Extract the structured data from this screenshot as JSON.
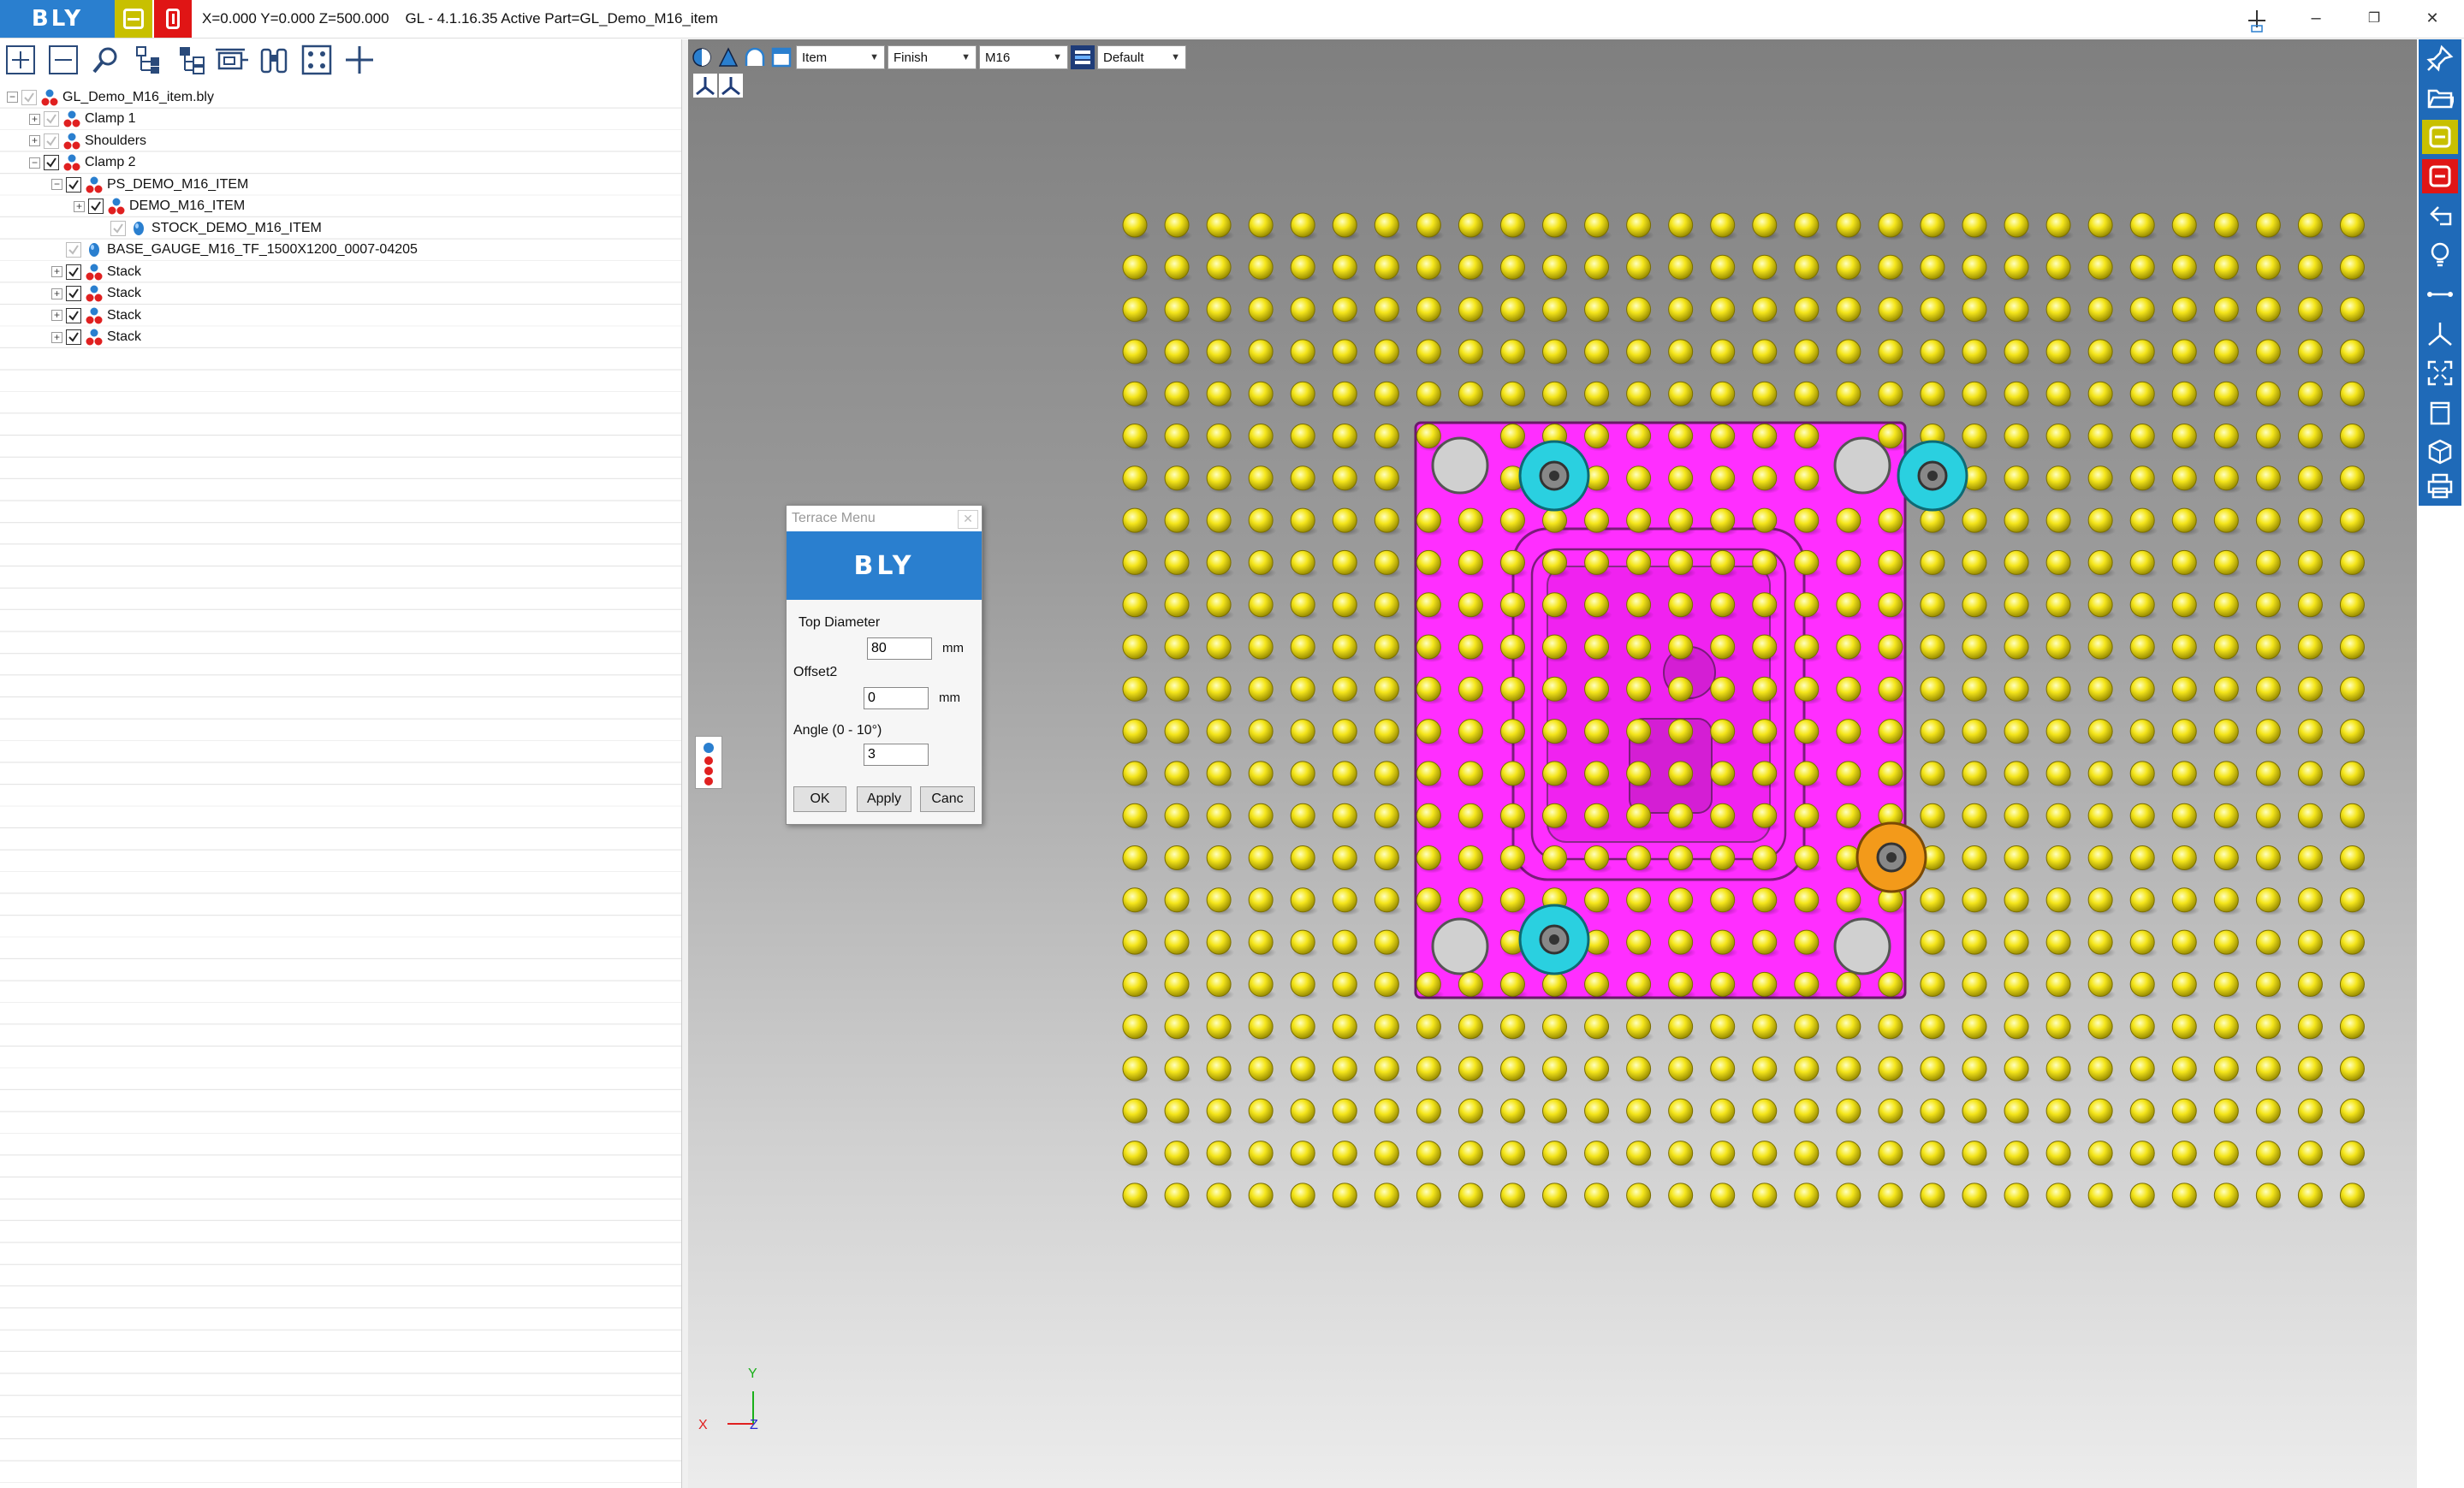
{
  "titlebar": {
    "logo": "BLY",
    "coords": "X=0.000 Y=0.000 Z=500.000",
    "title": "GL - 4.1.16.35 Active Part=GL_Demo_M16_item",
    "minimize": "–",
    "restore": "❐",
    "close": "✕"
  },
  "left_toolbar": [
    "zoom-in-icon",
    "zoom-out-icon",
    "search-icon",
    "tree-expand-icon",
    "tree-structure-icon",
    "mold-insert-icon",
    "binoculars-icon",
    "fit-points-icon",
    "crosshair-icon"
  ],
  "tree": {
    "items": [
      {
        "label": "GL_Demo_M16_item.bly",
        "indent": 0,
        "expander": "−",
        "check": "dim",
        "icon": "part"
      },
      {
        "label": "Clamp 1",
        "indent": 1,
        "expander": "+",
        "check": "dim",
        "icon": "part"
      },
      {
        "label": "Shoulders",
        "indent": 1,
        "expander": "+",
        "check": "dim",
        "icon": "part"
      },
      {
        "label": "Clamp 2",
        "indent": 1,
        "expander": "−",
        "check": "on",
        "icon": "part"
      },
      {
        "label": "PS_DEMO_M16_ITEM",
        "indent": 2,
        "expander": "−",
        "check": "on",
        "icon": "part"
      },
      {
        "label": "DEMO_M16_ITEM",
        "indent": 3,
        "expander": "+",
        "check": "on",
        "icon": "part"
      },
      {
        "label": "STOCK_DEMO_M16_ITEM",
        "indent": 4,
        "expander": "",
        "check": "dim",
        "icon": "drop"
      },
      {
        "label": "BASE_GAUGE_M16_TF_1500X1200_0007-04205",
        "indent": 2,
        "expander": "",
        "check": "dim",
        "icon": "drop"
      },
      {
        "label": "Stack",
        "indent": 2,
        "expander": "+",
        "check": "on",
        "icon": "part"
      },
      {
        "label": "Stack",
        "indent": 2,
        "expander": "+",
        "check": "on",
        "icon": "part"
      },
      {
        "label": "Stack",
        "indent": 2,
        "expander": "+",
        "check": "on",
        "icon": "part"
      },
      {
        "label": "Stack",
        "indent": 2,
        "expander": "+",
        "check": "on",
        "icon": "part"
      }
    ]
  },
  "viewport_toolbar": {
    "select1": "Item",
    "select2": "Finish",
    "select3": "M16",
    "select4": "Default"
  },
  "terrace_menu": {
    "title": "Terrace Menu",
    "logo": "BLY",
    "top_diameter_label": "Top Diameter",
    "top_diameter_value": "80",
    "top_diameter_unit": "mm",
    "offset2_label": "Offset2",
    "offset2_value": "0",
    "offset2_unit": "mm",
    "angle_label": "Angle (0 - 10°)",
    "angle_value": "3",
    "ok": "OK",
    "apply": "Apply",
    "cancel": "Canc"
  },
  "axes": {
    "y": "Y",
    "x": "X",
    "z": "Z"
  },
  "colors": {
    "brand_blue": "#2a7fcf",
    "part_magenta": "#ff2eff",
    "pin_yellow": "#f2e21a",
    "clamp_cyan": "#2ad0e0",
    "clamp_orange": "#f39a1a"
  }
}
